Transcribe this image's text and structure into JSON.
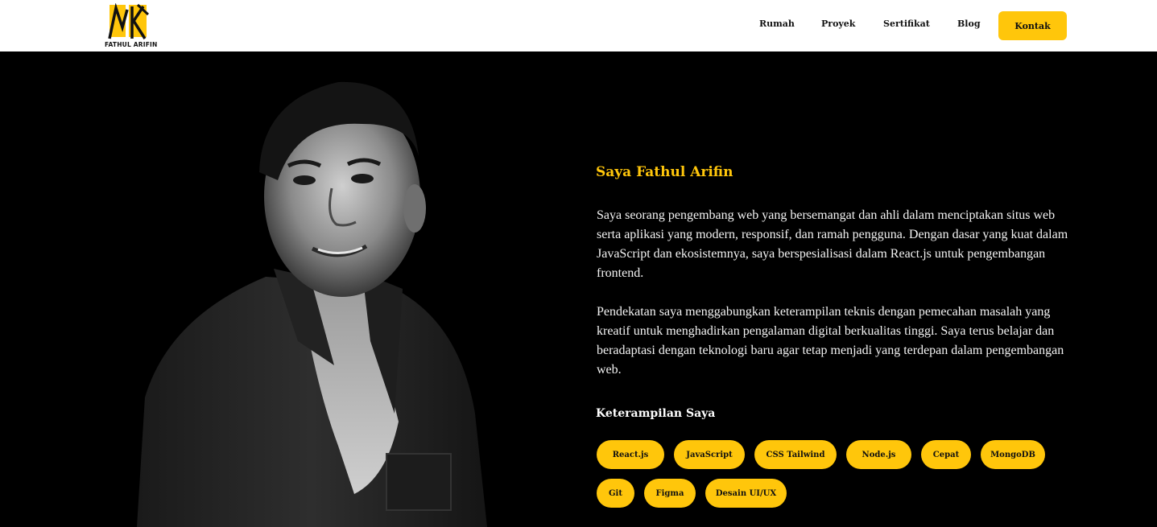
{
  "brand": {
    "logo_text": "FATHUL ARIFIN",
    "accent_color": "#FFC60B"
  },
  "nav": {
    "items": [
      {
        "label": "Rumah"
      },
      {
        "label": "Proyek"
      },
      {
        "label": "Sertifikat"
      },
      {
        "label": "Blog"
      }
    ],
    "contact_label": "Kontak"
  },
  "hero": {
    "title": "Saya Fathul Arifin",
    "bio_1": "Saya seorang pengembang web yang bersemangat dan ahli dalam menciptakan situs web serta aplikasi yang modern, responsif, dan ramah pengguna. Dengan dasar yang kuat dalam JavaScript dan ekosistemnya, saya berspesialisasi dalam React.js untuk pengembangan frontend.",
    "bio_2": "Pendekatan saya menggabungkan keterampilan teknis dengan pemecahan masalah yang kreatif untuk menghadirkan pengalaman digital berkualitas tinggi. Saya terus belajar dan beradaptasi dengan teknologi baru agar tetap menjadi yang terdepan dalam pengembangan web.",
    "portrait_icon": "person-portrait"
  },
  "skills": {
    "title": "Keterampilan Saya",
    "items": [
      "React.js",
      "JavaScript",
      "CSS Tailwind",
      "Node.js",
      "Cepat",
      "MongoDB",
      "Git",
      "Figma",
      "Desain UI/UX"
    ]
  }
}
